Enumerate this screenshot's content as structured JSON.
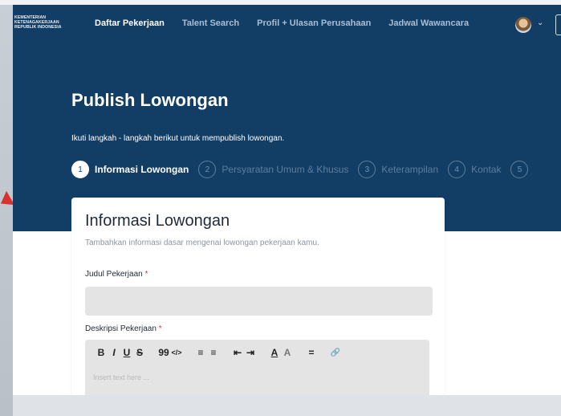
{
  "nav": {
    "logo_lines": [
      "KEMENTERIAN",
      "KETENAGAKERJAAN",
      "REPUBLIK INDONESIA"
    ],
    "links": [
      "Daftar Pekerjaan",
      "Talent Search",
      "Profil + Ulasan Perusahaan",
      "Jadwal Wawancara"
    ],
    "active_index": 0
  },
  "hero": {
    "title": "Publish Lowongan",
    "subtitle": "Ikuti langkah - langkah berikut untuk mempublish lowongan."
  },
  "steps": [
    {
      "num": "1",
      "label": "Informasi Lowongan"
    },
    {
      "num": "2",
      "label": "Persyaratan Umum & Khusus"
    },
    {
      "num": "3",
      "label": "Keterampilan"
    },
    {
      "num": "4",
      "label": "Kontak"
    },
    {
      "num": "5",
      "label": ""
    }
  ],
  "card": {
    "title": "Informasi Lowongan",
    "subtitle": "Tambahkan informasi dasar mengenai lowongan pekerjaan kamu.",
    "job_title_label": "Judul Pekerjaan",
    "job_desc_label": "Deskripsi Pekerjaan",
    "required_mark": "*",
    "editor_placeholder": "Insert text here ...",
    "job_title_value": ""
  },
  "toolbar": {
    "buttons": [
      "B",
      "I",
      "U",
      "S",
      "99",
      "</>",
      "≡",
      "≡",
      "⇤",
      "⇥",
      "A",
      "A",
      "=",
      "🔗"
    ]
  },
  "colors": {
    "navy": "#123e66",
    "required": "#d63a32",
    "field_bg": "#e4e4e4"
  }
}
